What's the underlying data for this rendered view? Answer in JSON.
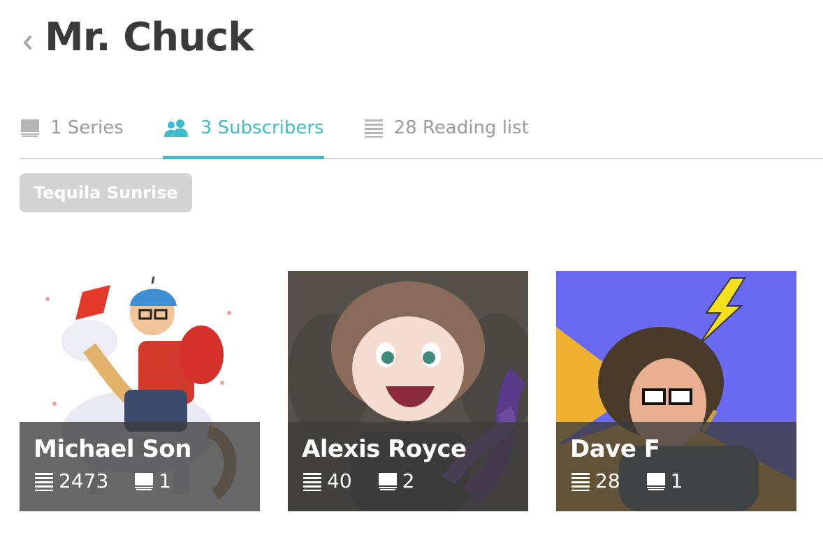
{
  "header": {
    "title": "Mr. Chuck",
    "back_icon": "chevron-left-icon"
  },
  "tabs": [
    {
      "label": "1 Series",
      "icon": "monitor-icon",
      "active": false
    },
    {
      "label": "3 Subscribers",
      "icon": "users-icon",
      "active": true
    },
    {
      "label": "28 Reading list",
      "icon": "list-icon",
      "active": false
    }
  ],
  "filter": {
    "tag_label": "Tequila Sunrise"
  },
  "subscribers": [
    {
      "name": "Michael Son",
      "reading_count": "2473",
      "series_count": "1"
    },
    {
      "name": "Alexis Royce",
      "reading_count": "40",
      "series_count": "2"
    },
    {
      "name": "Dave F",
      "reading_count": "28",
      "series_count": "1"
    }
  ],
  "colors": {
    "accent": "#3bbcd0",
    "muted": "#9b9b9b",
    "title": "#3a3a3a",
    "tag_bg": "#d3d3d3"
  }
}
